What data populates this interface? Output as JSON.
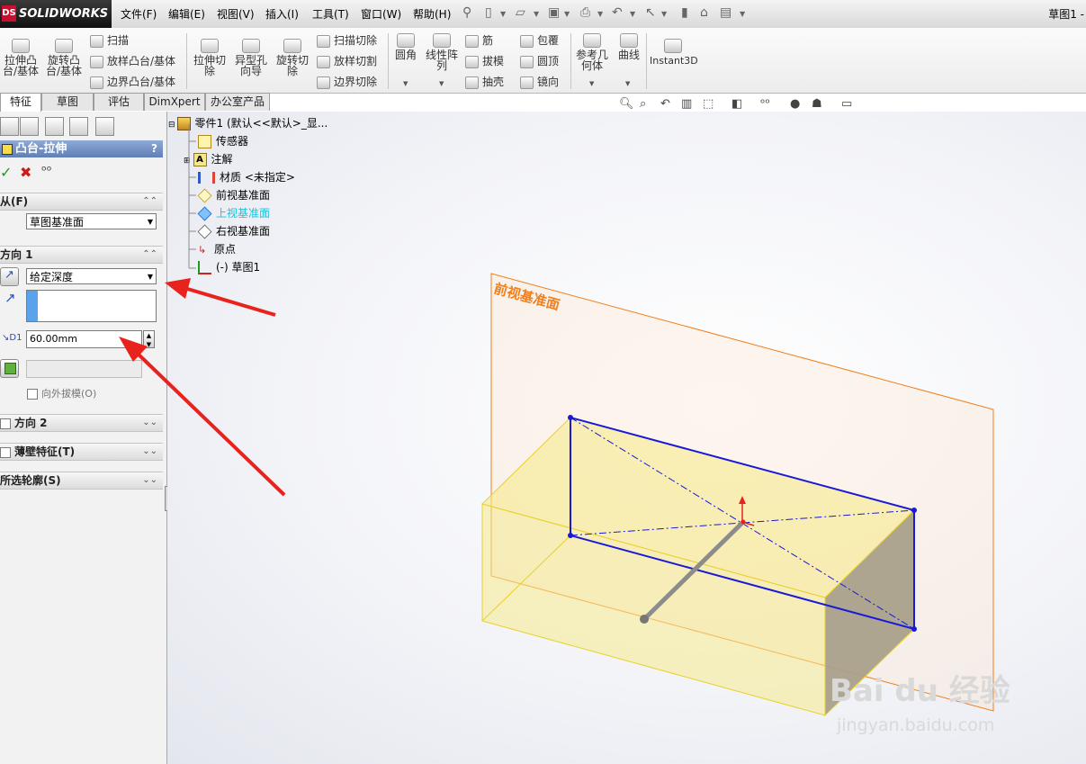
{
  "app": {
    "logo_text": "SOLIDWORKS",
    "logo_mark": "DS",
    "document_title": "草图1 -"
  },
  "menu": [
    "文件(F)",
    "编辑(E)",
    "视图(V)",
    "插入(I)",
    "工具(T)",
    "窗口(W)",
    "帮助(H)"
  ],
  "features_toolbar": {
    "extrude_boss": "拉伸凸台/基体",
    "revolve_boss": "旋转凸台/基体",
    "sweep": "扫描",
    "loft_boss": "放样凸台/基体",
    "boundary_boss": "边界凸台/基体",
    "extrude_cut": "拉伸切除",
    "hole_wizard": "异型孔向导",
    "revolve_cut": "旋转切除",
    "swept_cut": "扫描切除",
    "lofted_cut": "放样切割",
    "boundary_cut": "边界切除",
    "fillet": "圆角",
    "linear_pattern": "线性阵列",
    "rib": "筋",
    "draft": "拔模",
    "shell": "抽壳",
    "wrap": "包覆",
    "dome": "圆顶",
    "mirror": "镜向",
    "reference_geometry": "参考几何体",
    "curves": "曲线",
    "instant3d": "Instant3D"
  },
  "tabs": [
    "特征",
    "草图",
    "评估",
    "DimXpert",
    "办公室产品"
  ],
  "property_manager": {
    "title": "凸台-拉伸",
    "help": "?",
    "from_label": "从(F)",
    "from_value": "草图基准面",
    "direction1_label": "方向 1",
    "end_condition": "给定深度",
    "depth": "60.00mm",
    "draft_outward_label": "向外拔模(O)",
    "direction2_label": "方向 2",
    "thin_feature_label": "薄壁特征(T)",
    "selected_contours_label": "所选轮廓(S)"
  },
  "feature_tree": {
    "root": "零件1 (默认<<默认>_显...",
    "items": [
      "传感器",
      "注解",
      "材质 <未指定>",
      "前视基准面",
      "上视基准面",
      "右视基准面",
      "原点",
      "(-) 草图1"
    ]
  },
  "graphics": {
    "plane_label": "前视基准面",
    "watermark": "Bai du 经验",
    "watermark_sub": "jingyan.baidu.com"
  },
  "colors": {
    "plane_outline": "#f07f1c",
    "sketch_blue": "#1a1ad6",
    "preview_yellow": "#f6e98e",
    "annotation_red": "#e8221c",
    "tree_selected": "#13c4e0"
  }
}
